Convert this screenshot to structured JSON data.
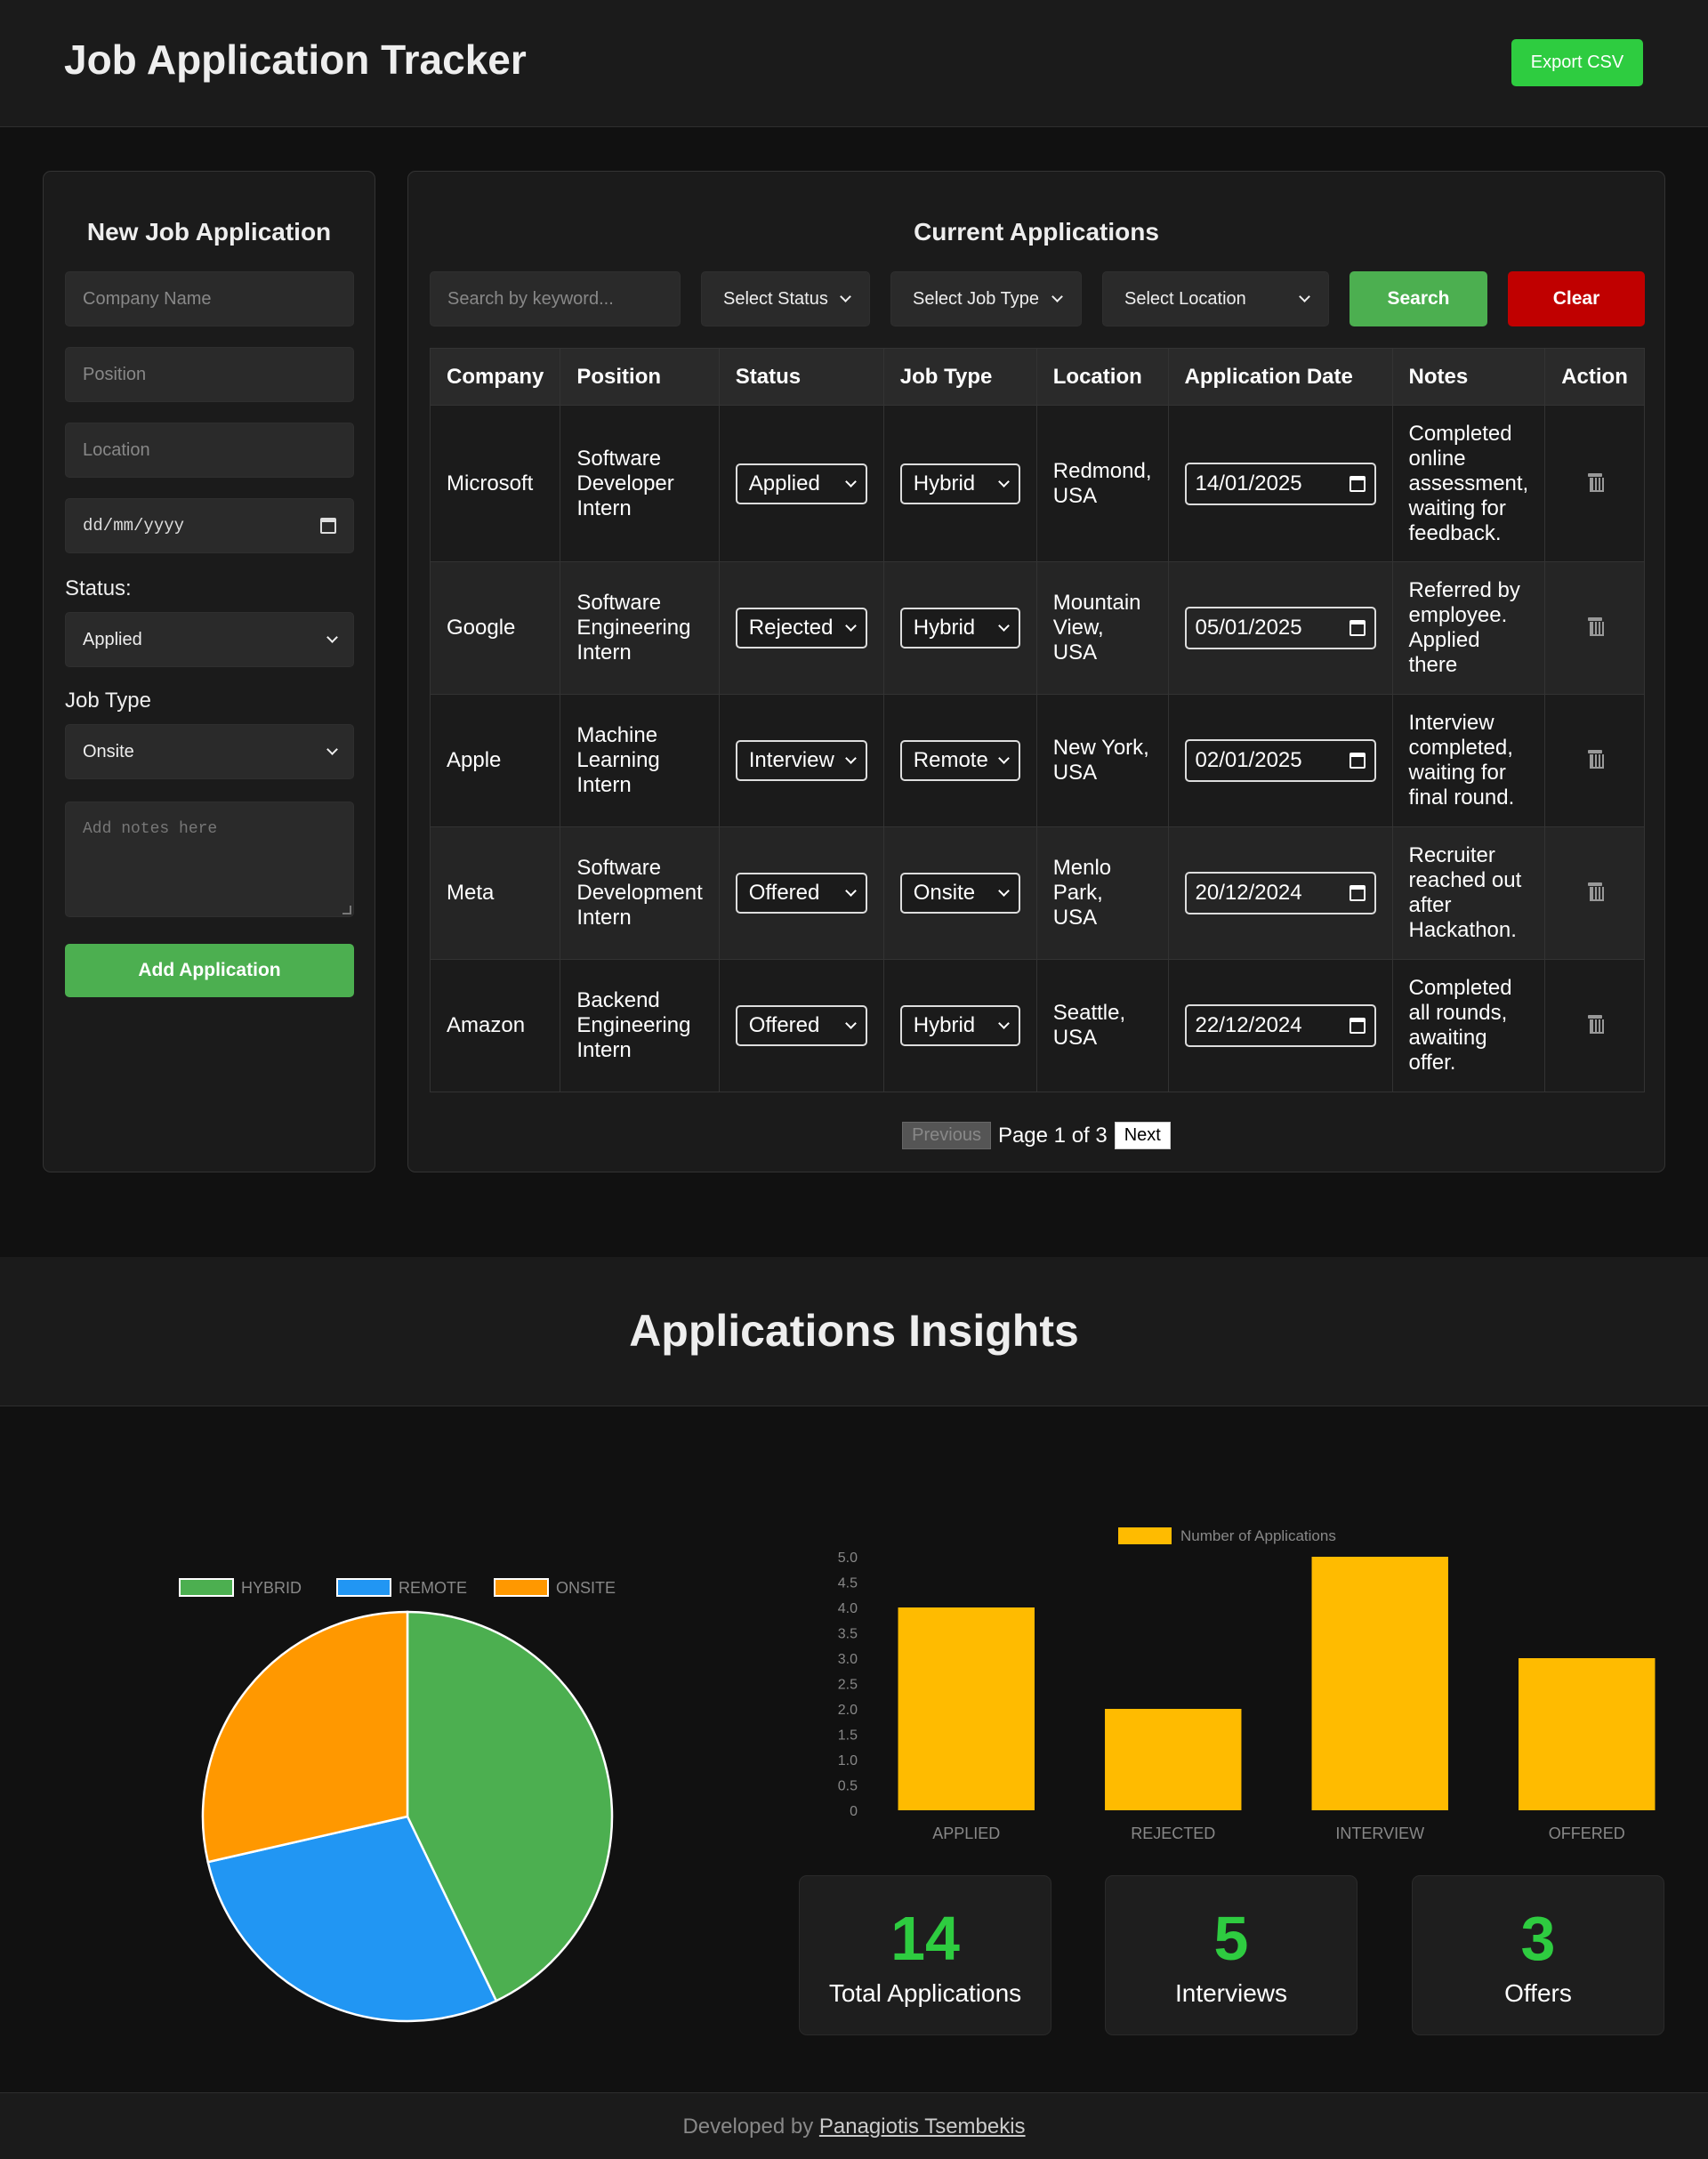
{
  "header": {
    "title": "Job Application Tracker",
    "export_label": "Export CSV"
  },
  "form": {
    "title": "New Job Application",
    "company_placeholder": "Company Name",
    "position_placeholder": "Position",
    "location_placeholder": "Location",
    "date_placeholder": "dd/mm/yyyy",
    "status_label": "Status:",
    "status_value": "Applied",
    "jobtype_label": "Job Type",
    "jobtype_value": "Onsite",
    "notes_placeholder": "Add notes here",
    "add_label": "Add Application"
  },
  "apps": {
    "title": "Current Applications",
    "search_placeholder": "Search by keyword...",
    "status_filter": "Select Status",
    "jobtype_filter": "Select Job Type",
    "location_filter": "Select Location",
    "search_label": "Search",
    "clear_label": "Clear",
    "columns": [
      "Company",
      "Position",
      "Status",
      "Job Type",
      "Location",
      "Application Date",
      "Notes",
      "Action"
    ],
    "rows": [
      {
        "company": "Microsoft",
        "position": "Software Developer Intern",
        "status": "Applied",
        "job_type": "Hybrid",
        "location": "Redmond, USA",
        "date": "14/01/2025",
        "notes": "Completed online assessment, waiting for feedback."
      },
      {
        "company": "Google",
        "position": "Software Engineering Intern",
        "status": "Rejected",
        "job_type": "Hybrid",
        "location": "Mountain View, USA",
        "date": "05/01/2025",
        "notes": "Referred by employee. Applied there"
      },
      {
        "company": "Apple",
        "position": "Machine Learning Intern",
        "status": "Interview",
        "job_type": "Remote",
        "location": "New York, USA",
        "date": "02/01/2025",
        "notes": "Interview completed, waiting for final round."
      },
      {
        "company": "Meta",
        "position": "Software Development Intern",
        "status": "Offered",
        "job_type": "Onsite",
        "location": "Menlo Park, USA",
        "date": "20/12/2024",
        "notes": "Recruiter reached out after Hackathon."
      },
      {
        "company": "Amazon",
        "position": "Backend Engineering Intern",
        "status": "Offered",
        "job_type": "Hybrid",
        "location": "Seattle, USA",
        "date": "22/12/2024",
        "notes": "Completed all rounds, awaiting offer."
      }
    ],
    "pagination": {
      "prev_label": "Previous",
      "page_text": "Page 1 of 3",
      "next_label": "Next"
    }
  },
  "insights": {
    "title": "Applications Insights",
    "stats": [
      {
        "value": "14",
        "label": "Total Applications"
      },
      {
        "value": "5",
        "label": "Interviews"
      },
      {
        "value": "3",
        "label": "Offers"
      }
    ]
  },
  "chart_data": [
    {
      "type": "pie",
      "labels": [
        "HYBRID",
        "REMOTE",
        "ONSITE"
      ],
      "values": [
        6,
        4,
        4
      ],
      "colors": [
        "#4caf50",
        "#2196f3",
        "#ff9800"
      ],
      "legend": "top"
    },
    {
      "type": "bar",
      "categories": [
        "APPLIED",
        "REJECTED",
        "INTERVIEW",
        "OFFERED"
      ],
      "series": [
        {
          "name": "Number of Applications",
          "values": [
            4,
            2,
            5,
            3
          ],
          "color": "#ffbb00"
        }
      ],
      "yticks": [
        "0",
        "0.5",
        "1.0",
        "1.5",
        "2.0",
        "2.5",
        "3.0",
        "3.5",
        "4.0",
        "4.5",
        "5.0"
      ],
      "ylim": [
        0,
        5
      ],
      "legend": "top"
    }
  ],
  "footer": {
    "prefix": "Developed by",
    "author": "Panagiotis Tsembekis"
  }
}
